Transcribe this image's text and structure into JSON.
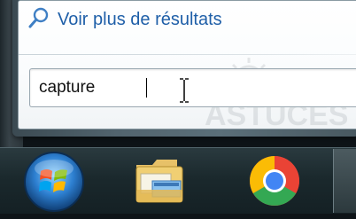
{
  "start_menu": {
    "more_results_label": "Voir plus de résultats",
    "search_input": {
      "value": "capture"
    }
  },
  "taskbar": {
    "start_button_icon": "windows-start-orb-icon",
    "pinned": [
      {
        "icon": "file-explorer-folder-icon"
      },
      {
        "icon": "chrome-icon"
      }
    ]
  },
  "colors": {
    "link_blue": "#1f5fa8",
    "taskbar_dark": "#1b292d",
    "menu_frame": "#52646e"
  }
}
